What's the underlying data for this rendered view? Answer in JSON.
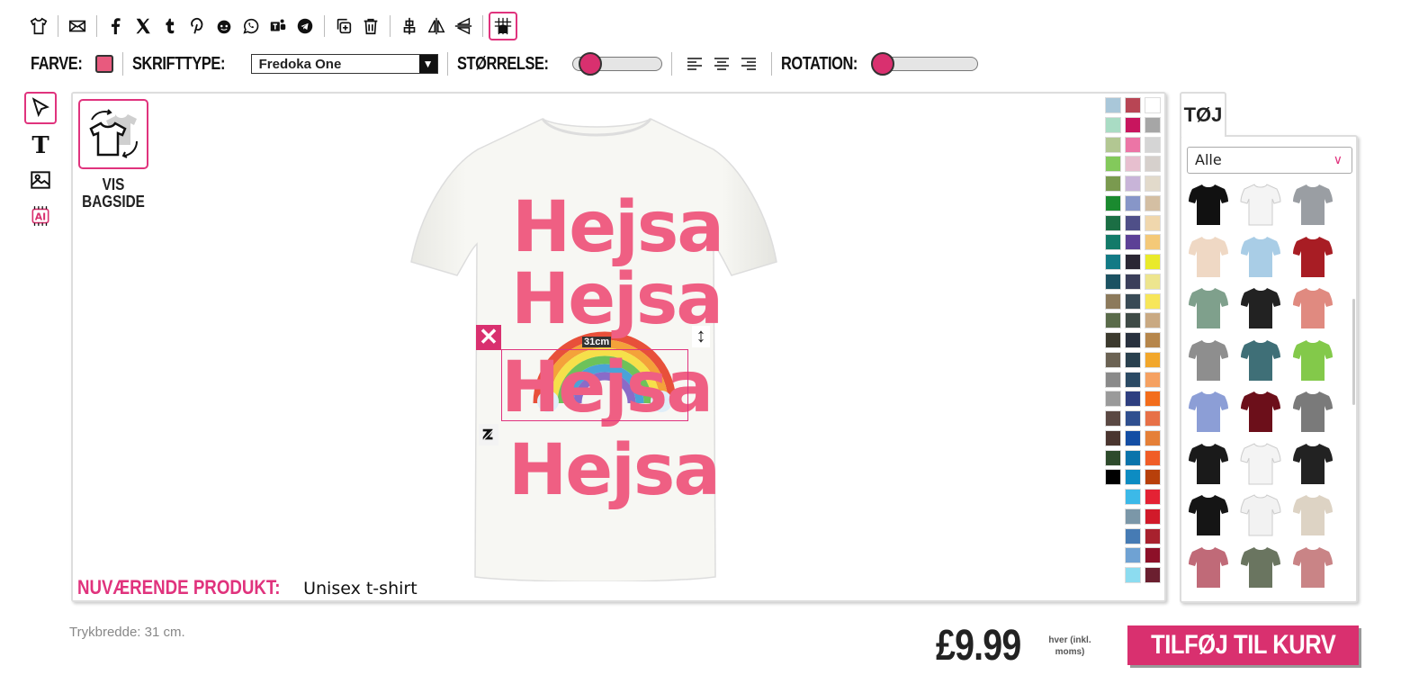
{
  "toolbar": {
    "icons": [
      "tshirt-icon",
      "email-icon",
      "facebook-icon",
      "x-icon",
      "tumblr-icon",
      "pinterest-icon",
      "reddit-icon",
      "whatsapp-icon",
      "teams-icon",
      "telegram-icon",
      "duplicate-icon",
      "trash-icon",
      "center-icon",
      "flip-horizontal-icon",
      "flip-vertical-icon",
      "grid-icon"
    ]
  },
  "options": {
    "color_label": "FARVE:",
    "color_value": "#e85a7e",
    "font_label": "SKRIFTTYPE:",
    "font_value": "Fredoka One",
    "size_label": "STØRRELSE:",
    "size_level": 0.18,
    "rotation_label": "ROTATION:",
    "rotation_level": 0.0
  },
  "side_tools": [
    "select-tool-icon",
    "text-tool-icon",
    "image-tool-icon",
    "ai-tool-icon"
  ],
  "canvas": {
    "backside_label_1": "VIS",
    "backside_label_2": "BAGSIDE",
    "text_lines": [
      "Hejsa",
      "Hejsa",
      "Hejsa",
      "Hejsa"
    ],
    "measure": "31cm",
    "current_product_label": "NUVÆRENDE PRODUKT:",
    "current_product_value": "Unisex t-shirt",
    "shirt_color": "#f6f6f2",
    "text_color": "#ef5f83"
  },
  "palette": [
    [
      "#a9c7d9",
      "#a9dcc4",
      "#b2c792",
      "#83c95b",
      "#7a9a4f",
      "#1a8a2f",
      "#1b6e44",
      "#137a69",
      "#127a85",
      "#1c5262",
      "#8c7a5c",
      "#5a6b4a",
      "#3c3a2e",
      "#6b6253",
      "#8a8a8a",
      "#9a9a9a",
      "#5a4843",
      "#4a352f",
      "#2d4a2b",
      "#000000"
    ],
    [
      "#b84554",
      "#c8155e",
      "#ec75a6",
      "#e7bfcf",
      "#c8b4d8",
      "#8796c8",
      "#4f4f88",
      "#5c4096",
      "#2a2633",
      "#3a3e5a",
      "#384a56",
      "#3e4a46",
      "#28313e",
      "#29404e",
      "#2b4a64",
      "#2e3f80",
      "#2f4f8f",
      "#134ea4",
      "#0a74ab",
      "#0d8cc2",
      "#3cb9e8",
      "#7b97a8",
      "#467bb4",
      "#6fa2d3",
      "#8cdcf0"
    ],
    [
      "#ffffff",
      "#a6a6a6",
      "#d5d5d5",
      "#d6d0cc",
      "#e2dacb",
      "#d4bfa3",
      "#f0d7ad",
      "#f4c978",
      "#e9ea2a",
      "#ede58e",
      "#f7e65a",
      "#c9a982",
      "#b6864b",
      "#f2a72c",
      "#f5a162",
      "#f36d1c",
      "#e77148",
      "#e58038",
      "#f05d27",
      "#b8400b",
      "#e42234",
      "#d11a2a",
      "#a8212e",
      "#8d1028",
      "#6b1f2f"
    ]
  ],
  "product_panel": {
    "tab_label": "TØJ",
    "category": "Alle"
  },
  "garments": [
    {
      "name": "black-tshirt",
      "color": "#111111"
    },
    {
      "name": "raglan-tshirt",
      "color": "#f4f4f4"
    },
    {
      "name": "grey-sweatshirt",
      "color": "#9a9ea3"
    },
    {
      "name": "beige-tshirt",
      "color": "#efd8c4"
    },
    {
      "name": "tie-dye-tshirt",
      "color": "#a9cde6"
    },
    {
      "name": "varsity-jacket",
      "color": "#a81d24"
    },
    {
      "name": "sage-longsleeve",
      "color": "#7fa08c"
    },
    {
      "name": "black-orange-hoodie",
      "color": "#222222"
    },
    {
      "name": "salmon-tank",
      "color": "#e08a80"
    },
    {
      "name": "grey-crop-top",
      "color": "#8e8e8e"
    },
    {
      "name": "gradient-longsleeve",
      "color": "#3f6f77"
    },
    {
      "name": "green-polo",
      "color": "#83c94a"
    },
    {
      "name": "blue-vneck",
      "color": "#8c9ed6"
    },
    {
      "name": "maroon-longsleeve",
      "color": "#6c0f1a"
    },
    {
      "name": "grey-polo",
      "color": "#7a7a7a"
    },
    {
      "name": "black-tee",
      "color": "#1a1a1a"
    },
    {
      "name": "white-ladies-tee",
      "color": "#f4f4f4"
    },
    {
      "name": "black-tank",
      "color": "#222222"
    },
    {
      "name": "black-womens-tee",
      "color": "#151515"
    },
    {
      "name": "white-tank",
      "color": "#f2f2f2"
    },
    {
      "name": "cream-cardigan",
      "color": "#ddd3c4"
    },
    {
      "name": "rose-longsleeve",
      "color": "#c06a78"
    },
    {
      "name": "olive-crop-tank",
      "color": "#6a7560"
    },
    {
      "name": "rose-tank",
      "color": "#c98486"
    }
  ],
  "footer": {
    "print_width": "Trykbredde: 31 cm.",
    "price": "£9.99",
    "price_note": "hver (inkl. moms)",
    "add_button": "TILFØJ TIL KURV"
  }
}
